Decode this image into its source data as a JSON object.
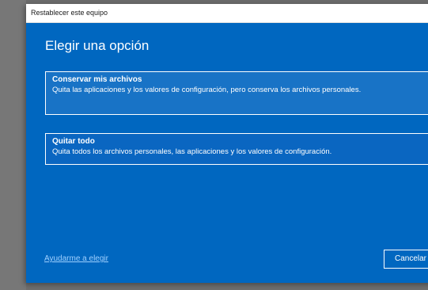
{
  "window": {
    "title": "Restablecer este equipo"
  },
  "dialog": {
    "heading": "Elegir una opción",
    "options": [
      {
        "title": "Conservar mis archivos",
        "description": "Quita las aplicaciones y los valores de configuración, pero conserva los archivos personales."
      },
      {
        "title": "Quitar todo",
        "description": "Quita todos los archivos personales, las aplicaciones y los valores de configuración."
      }
    ],
    "help_link": "Ayudarme a elegir",
    "cancel_label": "Cancelar"
  },
  "colors": {
    "dialog_background": "#0067c0",
    "selected_option_background": "#1873c6",
    "link": "#9fd0ff",
    "text": "#ffffff"
  }
}
